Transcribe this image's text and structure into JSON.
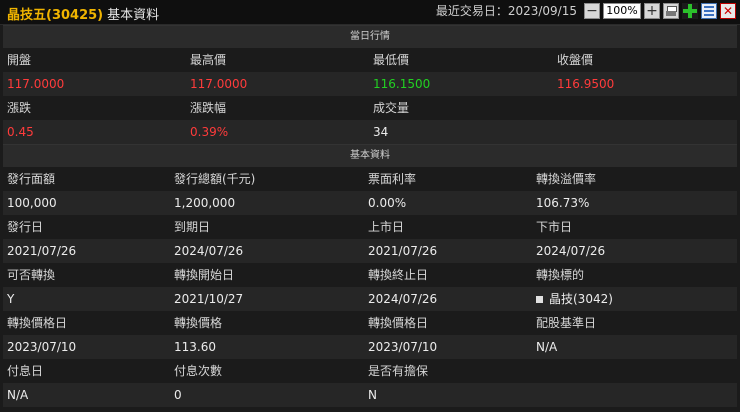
{
  "header": {
    "stock_name": "晶技五(30425)",
    "section_title": "基本資料",
    "last_trade_label": "最近交易日：",
    "last_trade_date": "2023/09/15",
    "zoom": "100%"
  },
  "quote": {
    "section_title": "當日行情",
    "row1_labels": [
      "開盤",
      "最高價",
      "最低價",
      "收盤價"
    ],
    "row1_values": [
      "117.0000",
      "117.0000",
      "116.1500",
      "116.9500"
    ],
    "row2_labels": [
      "漲跌",
      "漲跌幅",
      "成交量",
      ""
    ],
    "row2_values": [
      "0.45",
      "0.39%",
      "34",
      ""
    ]
  },
  "basic": {
    "section_title": "基本資料",
    "rows": [
      {
        "labels": [
          "發行面額",
          "發行總額(千元)",
          "票面利率",
          "轉換溢價率"
        ],
        "values": [
          "100,000",
          "1,200,000",
          "0.00%",
          "106.73%"
        ]
      },
      {
        "labels": [
          "發行日",
          "到期日",
          "上市日",
          "下市日"
        ],
        "values": [
          "2021/07/26",
          "2024/07/26",
          "2021/07/26",
          "2024/07/26"
        ]
      },
      {
        "labels": [
          "可否轉換",
          "轉換開始日",
          "轉換終止日",
          "轉換標的"
        ],
        "values": [
          "Y",
          "2021/10/27",
          "2024/07/26",
          "晶技(3042)"
        ]
      },
      {
        "labels": [
          "轉換價格日",
          "轉換價格",
          "轉換價格日",
          "配股基準日"
        ],
        "values": [
          "2023/07/10",
          "113.60",
          "2023/07/10",
          "N/A"
        ]
      },
      {
        "labels": [
          "付息日",
          "付息次數",
          "是否有擔保",
          ""
        ],
        "values": [
          "N/A",
          "0",
          "N",
          ""
        ]
      }
    ]
  },
  "colors": {
    "up": "#ff3b3b",
    "down": "#22d022",
    "code": "#f0b400"
  }
}
